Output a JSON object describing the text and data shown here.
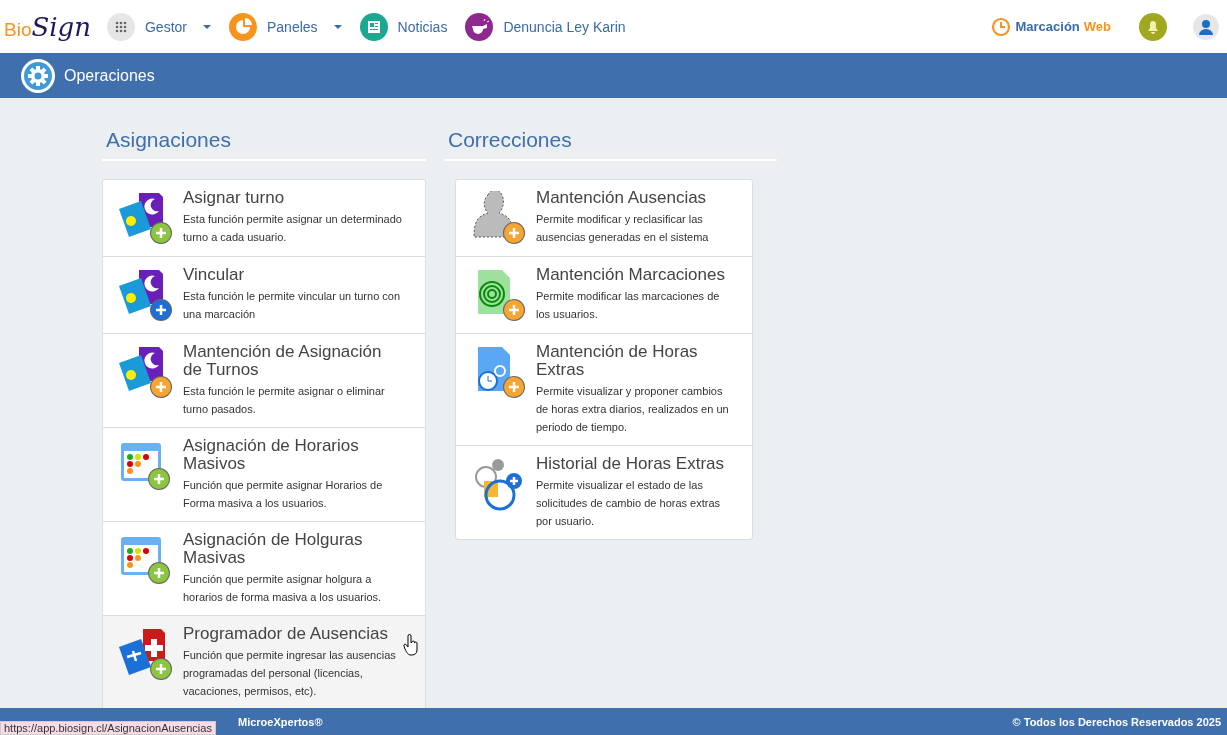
{
  "logo": {
    "part_1": "Bio",
    "part_2": "Sign"
  },
  "nav": [
    {
      "label": "Gestor",
      "dropdown": true,
      "color": "#e6e6e6"
    },
    {
      "label": "Paneles",
      "dropdown": true,
      "color": "#f7941d"
    },
    {
      "label": "Noticias",
      "dropdown": false,
      "color": "#1aa891"
    },
    {
      "label": "Denuncia Ley Karin",
      "dropdown": false,
      "color": "#8e2a8e"
    }
  ],
  "marcacion": {
    "label": "Marcación",
    "accent": "Web"
  },
  "band": {
    "title": "Operaciones"
  },
  "sections": [
    {
      "heading": "Asignaciones",
      "items": [
        {
          "title": "Asignar turno",
          "text": "Esta función permite asignar un determinado turno a cada usuario.",
          "hovered": false
        },
        {
          "title": "Vincular",
          "text": "Esta función le permite vincular un turno con una marcación",
          "hovered": false
        },
        {
          "title": "Mantención de Asignación de Turnos",
          "text": "Esta función le permite asignar o eliminar turno pasados.",
          "hovered": false
        },
        {
          "title": "Asignación de Horarios Masivos",
          "text": "Función que permite asignar Horarios de Forma masiva a los usuarios.",
          "hovered": false
        },
        {
          "title": "Asignación de Holguras Masivas",
          "text": "Función que permite asignar holgura a horarios de forma masiva a los usuarios.",
          "hovered": false
        },
        {
          "title": "Programador de Ausencias",
          "text": "Función que permite ingresar las ausencias programadas del personal (licencias, vacaciones, permisos, etc).",
          "hovered": true
        }
      ]
    },
    {
      "heading": "Correcciones",
      "items": [
        {
          "title": "Mantención Ausencias",
          "text": "Permite modificar y reclasificar las ausencias generadas en el sistema",
          "hovered": false
        },
        {
          "title": "Mantención Marcaciones",
          "text": "Permite modificar las marcaciones de los usuarios.",
          "hovered": false
        },
        {
          "title": "Mantención de Horas Extras",
          "text": "Permite visualizar y proponer cambios de horas extra diarios, realizados en un periodo de tiempo.",
          "hovered": false
        },
        {
          "title": "Historial de Horas Extras",
          "text": "Permite visualizar el estado de las solicitudes de cambio de horas extras por usuario.",
          "hovered": false
        }
      ]
    }
  ],
  "footer": {
    "left": "MicroeXpertos®",
    "right": "© Todos los Derechos Reservados 2025"
  },
  "status_url": "https://app.biosign.cl/AsignacionAusencias"
}
